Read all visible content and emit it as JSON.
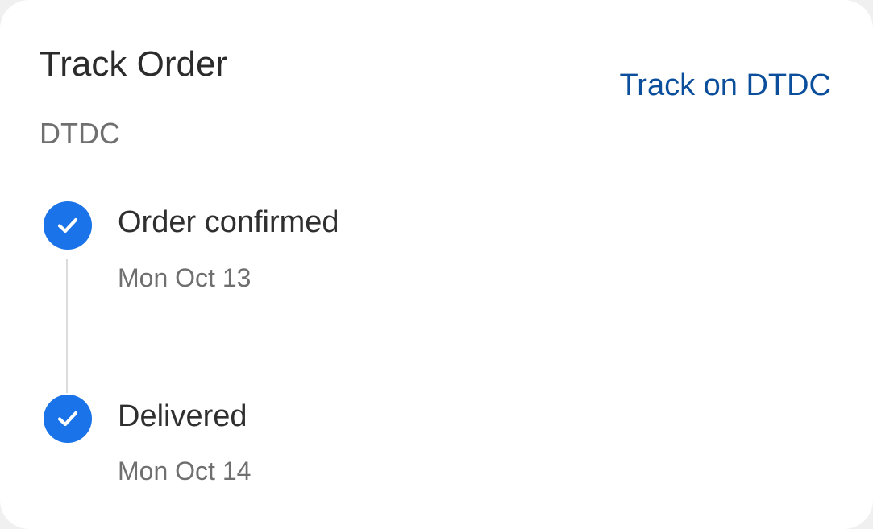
{
  "header": {
    "title": "Track Order",
    "carrier": "DTDC",
    "track_link_label": "Track on DTDC"
  },
  "steps": [
    {
      "label": "Order confirmed",
      "date": "Mon Oct 13",
      "status_icon": "check-circle-icon"
    },
    {
      "label": "Delivered",
      "date": "Mon Oct 14",
      "status_icon": "check-circle-icon"
    }
  ],
  "colors": {
    "accent": "#1a73e8",
    "link": "#0b4f9c",
    "primary_text": "#2b2b2b",
    "secondary_text": "#6f6f6f",
    "timeline_line": "#dcdcdc"
  }
}
